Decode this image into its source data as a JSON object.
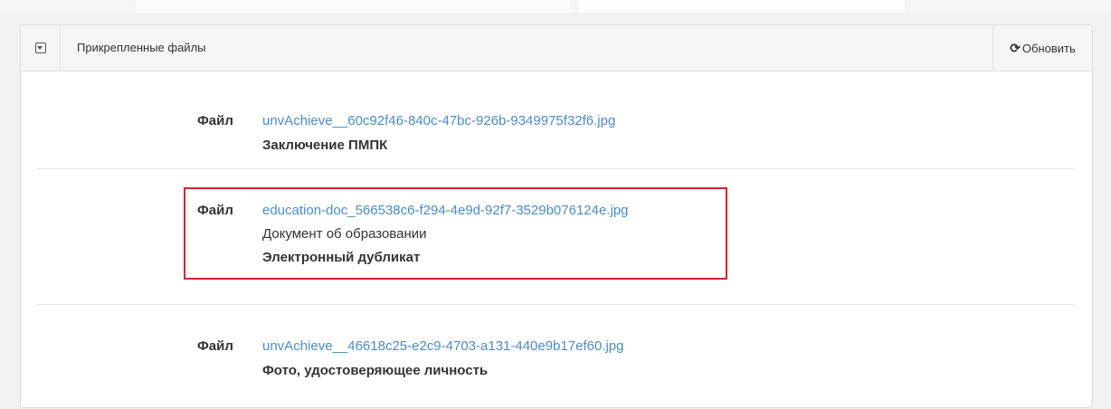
{
  "panel": {
    "title": "Прикрепленные файлы",
    "refresh_label": "Обновить"
  },
  "files": [
    {
      "label": "Файл",
      "filename": "unvAchieve__60c92f46-840c-47bc-926b-9349975f32f6.jpg",
      "lines": [
        "Заключение ПМПК"
      ]
    },
    {
      "label": "Файл",
      "filename": "education-doc_566538c6-f294-4e9d-92f7-3529b076124e.jpg",
      "lines": [
        "Документ об образовании",
        "Электронный дубликат"
      ],
      "highlighted": true
    },
    {
      "label": "Файл",
      "filename": "unvAchieve__46618c25-e2c9-4703-a131-440e9b17ef60.jpg",
      "lines": [
        "Фото, удостоверяющее личность"
      ]
    }
  ],
  "colors": {
    "link": "#4b8cc8",
    "highlight_border": "#d9232d"
  },
  "icons": {
    "collapse": "collapse-toggle-icon",
    "refresh": "refresh-icon"
  }
}
